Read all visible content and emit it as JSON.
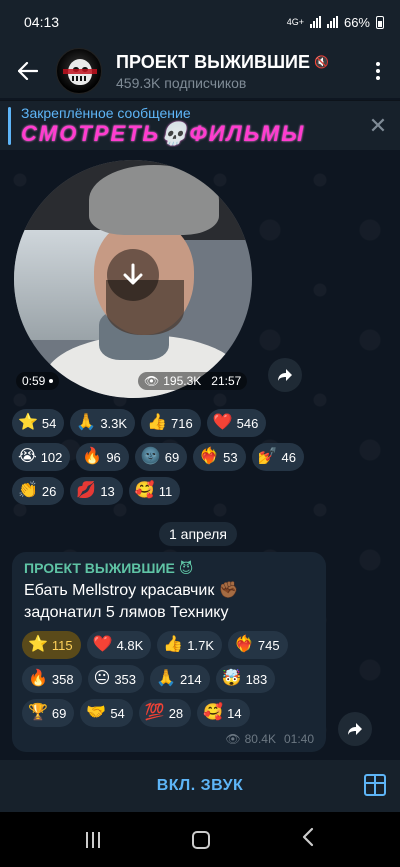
{
  "status": {
    "time": "04:13",
    "network": "4G+",
    "battery": "66%"
  },
  "header": {
    "title": "ПРОЕКТ ВЫЖИВШИЕ",
    "subtitle": "459.3K подписчиков",
    "avatar_text": "ПРОЕКТ ВЫЖИВШИЕ"
  },
  "pinned": {
    "label": "Закреплённое сообщение",
    "text": "СМОТРЕТЬ💀ФИЛЬМЫ"
  },
  "video": {
    "duration": "0:59",
    "views": "195.3K",
    "time": "21:57",
    "reactions": [
      {
        "emoji": "⭐",
        "count": "54"
      },
      {
        "emoji": "🙏",
        "count": "3.3K"
      },
      {
        "emoji": "👍",
        "count": "716"
      },
      {
        "emoji": "❤️",
        "count": "546"
      },
      {
        "emoji": "😭",
        "count": "102"
      },
      {
        "emoji": "🔥",
        "count": "96"
      },
      {
        "emoji": "🌚",
        "count": "69"
      },
      {
        "emoji": "❤️‍🔥",
        "count": "53"
      },
      {
        "emoji": "💅",
        "count": "46"
      },
      {
        "emoji": "👏",
        "count": "26"
      },
      {
        "emoji": "💋",
        "count": "13"
      },
      {
        "emoji": "🥰",
        "count": "11"
      }
    ]
  },
  "date_divider": "1 апреля",
  "message": {
    "author": "ПРОЕКТ ВЫЖИВШИЕ 😈",
    "text": "Ебать Mellstroy красавчик ✊🏾 задонатил 5 лямов Технику",
    "views": "80.4K",
    "time": "01:40",
    "reactions": [
      {
        "emoji": "⭐",
        "count": "115",
        "active": true
      },
      {
        "emoji": "❤️",
        "count": "4.8K"
      },
      {
        "emoji": "👍",
        "count": "1.7K"
      },
      {
        "emoji": "❤️‍🔥",
        "count": "745"
      },
      {
        "emoji": "🔥",
        "count": "358"
      },
      {
        "emoji": "😐",
        "count": "353"
      },
      {
        "emoji": "🙏",
        "count": "214"
      },
      {
        "emoji": "🤯",
        "count": "183"
      },
      {
        "emoji": "🏆",
        "count": "69"
      },
      {
        "emoji": "🤝",
        "count": "54"
      },
      {
        "emoji": "💯",
        "count": "28"
      },
      {
        "emoji": "🥰",
        "count": "14"
      }
    ]
  },
  "bottom_bar": {
    "sound_label": "ВКЛ. ЗВУК"
  },
  "colors": {
    "accent": "#5eb5f7",
    "author": "#5fc4a5",
    "pinned_text": "#ff3ccf"
  }
}
